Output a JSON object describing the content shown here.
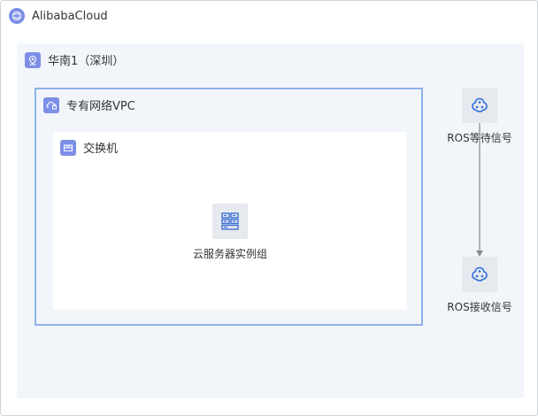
{
  "cloud": {
    "title": "AlibabaCloud"
  },
  "region": {
    "title": "华南1（深圳）"
  },
  "vpc": {
    "title": "专有网络VPC"
  },
  "vswitch": {
    "title": "交换机"
  },
  "ecs_group": {
    "label": "云服务器实例组"
  },
  "ros_wait": {
    "label": "ROS等待信号"
  },
  "ros_receive": {
    "label": "ROS接收信号"
  },
  "colors": {
    "accent_icon": "#7c8fe6",
    "vpc_border": "#8eb1ea",
    "region_bg": "#f2f6fa",
    "ros_icon": "#2f6fdf",
    "ecs_icon": "#3a6fd8",
    "arrow": "#8c8c8c"
  },
  "edges": [
    {
      "from": "ros_wait",
      "to": "ros_receive"
    }
  ]
}
